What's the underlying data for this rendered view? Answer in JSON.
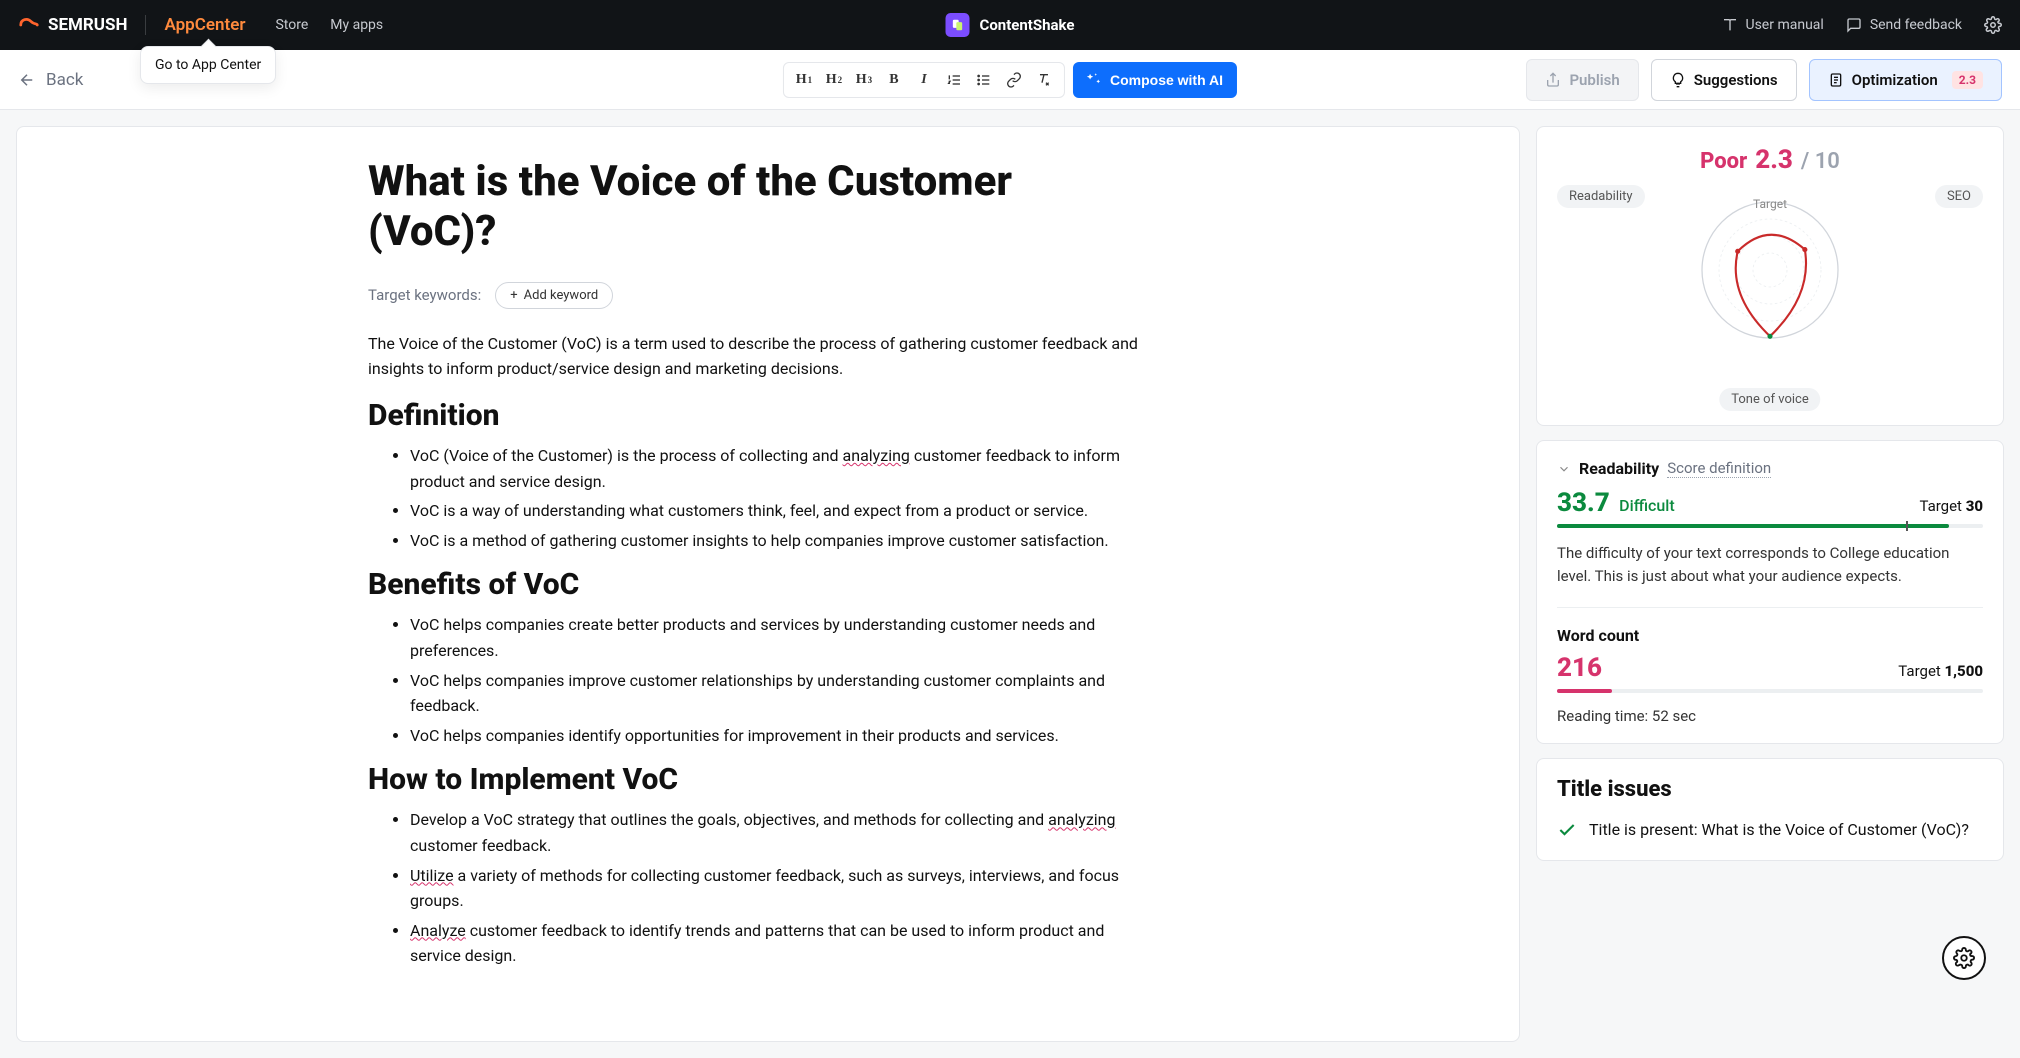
{
  "topbar": {
    "brand": "SEMRUSH",
    "appcenter": "AppCenter",
    "nav": {
      "store": "Store",
      "myapps": "My apps"
    },
    "center_app": "ContentShake",
    "manual": "User manual",
    "feedback": "Send feedback",
    "tooltip": "Go to App Center"
  },
  "toolbar": {
    "back": "Back",
    "compose": "Compose with AI",
    "publish": "Publish",
    "suggestions": "Suggestions",
    "optimization": "Optimization",
    "opt_score": "2.3"
  },
  "article": {
    "title": "What is the Voice of the Customer (VoC)?",
    "keywords_label": "Target keywords:",
    "add_keyword": "Add keyword",
    "intro": "The Voice of the Customer (VoC) is a term used to describe the process of gathering customer feedback and insights to inform product/service design and marketing decisions.",
    "h2_def": "Definition",
    "def_items": [
      {
        "pre": "VoC (Voice of the Customer) is the process of collecting and ",
        "u": "analyzing",
        "post": " customer feedback to inform product and service design."
      },
      {
        "pre": "VoC is a way of understanding what customers think, feel, and expect from a product or service.",
        "u": "",
        "post": ""
      },
      {
        "pre": "VoC is a method of gathering customer insights to help companies improve customer satisfaction.",
        "u": "",
        "post": ""
      }
    ],
    "h2_ben": "Benefits of VoC",
    "ben_items": [
      "VoC helps companies create better products and services by understanding customer needs and preferences.",
      "VoC helps companies improve customer relationships by understanding customer complaints and feedback.",
      "VoC helps companies identify opportunities for improvement in their products and services."
    ],
    "h2_impl": "How to Implement VoC",
    "impl_items": [
      {
        "pre": "Develop a VoC strategy that outlines the goals, objectives, and methods for collecting and ",
        "u": "analyzing",
        "post": " customer feedback."
      },
      {
        "pre": "",
        "u": "Utilize",
        "post": " a variety of methods for collecting customer feedback, such as surveys, interviews, and focus groups."
      },
      {
        "pre": "",
        "u": "Analyze",
        "post": " customer feedback to identify trends and patterns that can be used to inform product and service design."
      }
    ]
  },
  "sidebar": {
    "score_word": "Poor",
    "score_num": "2.3",
    "score_max": "/ 10",
    "radar": {
      "readability": "Readability",
      "seo": "SEO",
      "tone": "Tone of voice",
      "target": "Target"
    },
    "readability": {
      "title": "Readability",
      "def": "Score definition",
      "value": "33.7",
      "tag": "Difficult",
      "target_label": "Target ",
      "target_val": "30",
      "desc": "The difficulty of your text corresponds to College education level. This is just about what your audience expects."
    },
    "wordcount": {
      "title": "Word count",
      "value": "216",
      "target_label": "Target ",
      "target_val": "1,500",
      "reading": "Reading time: 52 sec"
    },
    "issues": {
      "title": "Title issues",
      "item1": "Title is present: What is the Voice of Customer (VoC)?"
    }
  },
  "chart_data": {
    "type": "radar",
    "axes": [
      "Readability",
      "SEO",
      "Tone of voice"
    ],
    "target": [
      1.0,
      1.0,
      1.0
    ],
    "values": [
      0.55,
      0.6,
      0.98
    ],
    "colors": {
      "target": "#d1d5db",
      "value": "#c92a2a"
    }
  }
}
